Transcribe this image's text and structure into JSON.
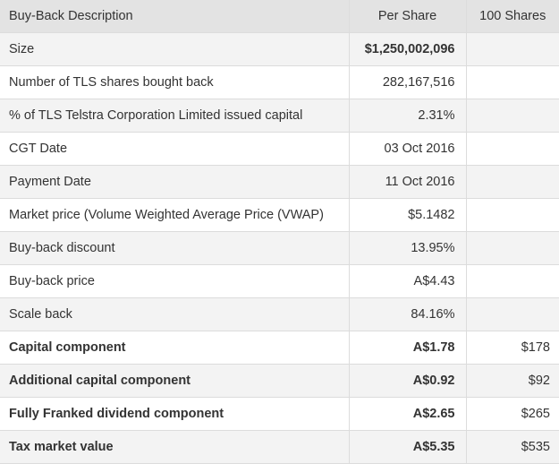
{
  "table": {
    "headers": [
      "Buy-Back Description",
      "Per Share",
      "100 Shares"
    ],
    "rows": [
      {
        "desc": "Size",
        "per_share": "$1,250,002,096",
        "hundred": ""
      },
      {
        "desc": "Number of TLS shares bought back",
        "per_share": "282,167,516",
        "hundred": ""
      },
      {
        "desc": "% of TLS Telstra Corporation Limited issued capital",
        "per_share": "2.31%",
        "hundred": ""
      },
      {
        "desc": "CGT Date",
        "per_share": "03 Oct 2016",
        "hundred": ""
      },
      {
        "desc": "Payment Date",
        "per_share": "11 Oct 2016",
        "hundred": ""
      },
      {
        "desc": "Market price (Volume Weighted Average Price (VWAP)",
        "per_share": "$5.1482",
        "hundred": ""
      },
      {
        "desc": "Buy-back discount",
        "per_share": "13.95%",
        "hundred": ""
      },
      {
        "desc": "Buy-back price",
        "per_share": "A$4.43",
        "hundred": ""
      },
      {
        "desc": "Scale back",
        "per_share": "84.16%",
        "hundred": ""
      },
      {
        "desc": "Capital component",
        "per_share": "A$1.78",
        "hundred": "$178"
      },
      {
        "desc": "Additional capital component",
        "per_share": "A$0.92",
        "hundred": "$92"
      },
      {
        "desc": "Fully Franked dividend component",
        "per_share": "A$2.65",
        "hundred": "$265"
      },
      {
        "desc": "Tax market value",
        "per_share": "A$5.35",
        "hundred": "$535"
      }
    ]
  }
}
